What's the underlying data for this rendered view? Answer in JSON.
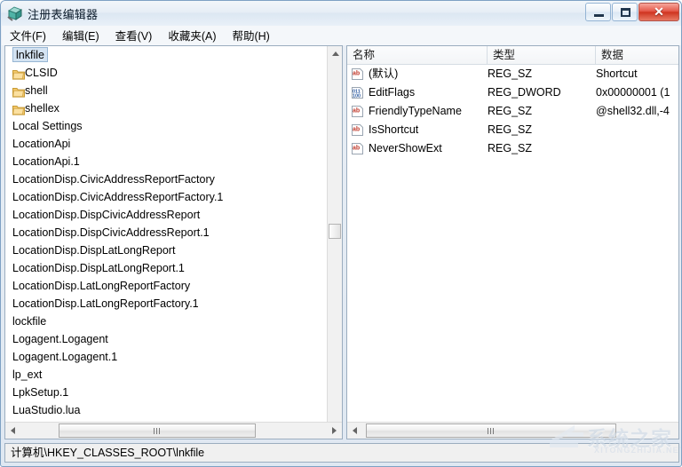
{
  "window": {
    "title": "注册表编辑器",
    "app_icon": "registry-editor-icon",
    "buttons": {
      "minimize": "minimize-icon",
      "maximize": "restore-icon",
      "close": "✕"
    }
  },
  "menubar": {
    "items": [
      {
        "label": "文件(F)",
        "name": "menu-file"
      },
      {
        "label": "编辑(E)",
        "name": "menu-edit"
      },
      {
        "label": "查看(V)",
        "name": "menu-view"
      },
      {
        "label": "收藏夹(A)",
        "name": "menu-favorites"
      },
      {
        "label": "帮助(H)",
        "name": "menu-help"
      }
    ]
  },
  "tree": {
    "items": [
      {
        "label": "lnkfile",
        "indent": 0,
        "icon": "none",
        "selected": true
      },
      {
        "label": "CLSID",
        "indent": 1,
        "icon": "folder-icon",
        "selected": false
      },
      {
        "label": "shell",
        "indent": 1,
        "icon": "folder-icon",
        "selected": false
      },
      {
        "label": "shellex",
        "indent": 1,
        "icon": "folder-icon",
        "selected": false
      },
      {
        "label": "Local Settings",
        "indent": 0,
        "icon": "none",
        "selected": false
      },
      {
        "label": "LocationApi",
        "indent": 0,
        "icon": "none",
        "selected": false
      },
      {
        "label": "LocationApi.1",
        "indent": 0,
        "icon": "none",
        "selected": false
      },
      {
        "label": "LocationDisp.CivicAddressReportFactory",
        "indent": 0,
        "icon": "none",
        "selected": false
      },
      {
        "label": "LocationDisp.CivicAddressReportFactory.1",
        "indent": 0,
        "icon": "none",
        "selected": false
      },
      {
        "label": "LocationDisp.DispCivicAddressReport",
        "indent": 0,
        "icon": "none",
        "selected": false
      },
      {
        "label": "LocationDisp.DispCivicAddressReport.1",
        "indent": 0,
        "icon": "none",
        "selected": false
      },
      {
        "label": "LocationDisp.DispLatLongReport",
        "indent": 0,
        "icon": "none",
        "selected": false
      },
      {
        "label": "LocationDisp.DispLatLongReport.1",
        "indent": 0,
        "icon": "none",
        "selected": false
      },
      {
        "label": "LocationDisp.LatLongReportFactory",
        "indent": 0,
        "icon": "none",
        "selected": false
      },
      {
        "label": "LocationDisp.LatLongReportFactory.1",
        "indent": 0,
        "icon": "none",
        "selected": false
      },
      {
        "label": "lockfile",
        "indent": 0,
        "icon": "none",
        "selected": false
      },
      {
        "label": "Logagent.Logagent",
        "indent": 0,
        "icon": "none",
        "selected": false
      },
      {
        "label": "Logagent.Logagent.1",
        "indent": 0,
        "icon": "none",
        "selected": false
      },
      {
        "label": "lp_ext",
        "indent": 0,
        "icon": "none",
        "selected": false
      },
      {
        "label": "LpkSetup.1",
        "indent": 0,
        "icon": "none",
        "selected": false
      },
      {
        "label": "LuaStudio.lua",
        "indent": 0,
        "icon": "none",
        "selected": false
      }
    ]
  },
  "list": {
    "columns": [
      {
        "label": "名称",
        "name": "column-name"
      },
      {
        "label": "类型",
        "name": "column-type"
      },
      {
        "label": "数据",
        "name": "column-data"
      }
    ],
    "rows": [
      {
        "icon": "string-value-icon",
        "name": "(默认)",
        "type": "REG_SZ",
        "data": "Shortcut"
      },
      {
        "icon": "dword-value-icon",
        "name": "EditFlags",
        "type": "REG_DWORD",
        "data": "0x00000001 (1"
      },
      {
        "icon": "string-value-icon",
        "name": "FriendlyTypeName",
        "type": "REG_SZ",
        "data": "@shell32.dll,-4"
      },
      {
        "icon": "string-value-icon",
        "name": "IsShortcut",
        "type": "REG_SZ",
        "data": ""
      },
      {
        "icon": "string-value-icon",
        "name": "NeverShowExt",
        "type": "REG_SZ",
        "data": ""
      }
    ]
  },
  "statusbar": {
    "path": "计算机\\HKEY_CLASSES_ROOT\\lnkfile"
  },
  "watermark": {
    "text": "系统之家",
    "url": "XITONGZHIJIA.NET"
  },
  "colors": {
    "close_button": "#cf3420",
    "selection": "#d4e3f2",
    "string_icon": "#c0392b",
    "dword_icon": "#2c5aa0"
  }
}
